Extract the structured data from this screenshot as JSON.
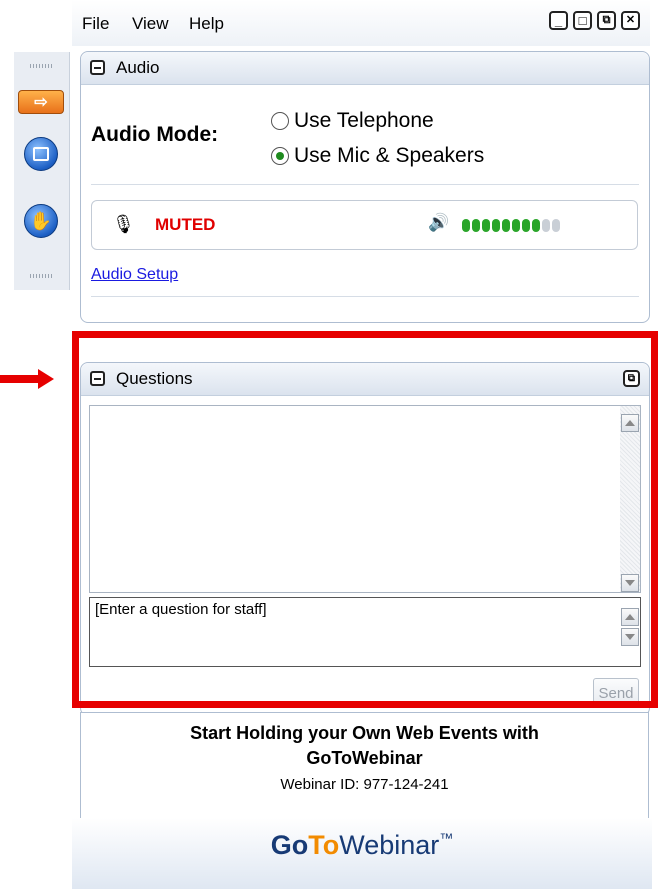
{
  "menu": {
    "file": "File",
    "view": "View",
    "help": "Help"
  },
  "window_buttons": {
    "minimize": "_",
    "maximize": "□",
    "restore": "⧉",
    "close": "✕"
  },
  "audio_panel": {
    "title": "Audio",
    "mode_label": "Audio Mode:",
    "options": [
      "Use Telephone",
      "Use Mic & Speakers"
    ],
    "selected_index": 1,
    "mic_status": "MUTED",
    "speaker_level": {
      "filled": 8,
      "total": 10
    },
    "setup_link": "Audio Setup"
  },
  "questions_panel": {
    "title": "Questions",
    "input_placeholder": "[Enter a question for staff]",
    "send_label": "Send"
  },
  "promo": {
    "headline_line1": "Start Holding your Own Web Events with",
    "headline_line2": "GoToWebinar",
    "webinar_id": "Webinar ID: 977-124-241"
  },
  "brand": {
    "go": "Go",
    "to": "To",
    "webinar": "Webinar",
    "tm": "™"
  },
  "colors": {
    "highlight": "#e60000",
    "muted": "#e00000",
    "level_on": "#2aa52a",
    "level_off": "#c9cfd6",
    "link": "#1a1ae0"
  }
}
